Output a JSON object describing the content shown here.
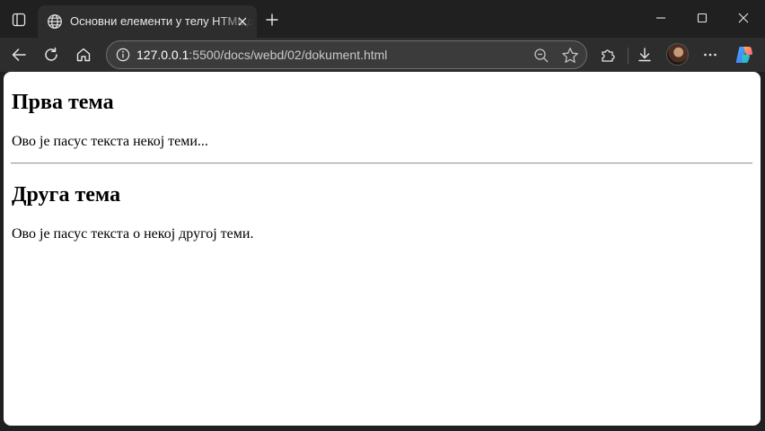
{
  "browser": {
    "tab": {
      "title": "Основни елементи у телу HTML документа"
    },
    "address_bar": {
      "url_host": "127.0.0.1",
      "url_rest": ":5500/docs/webd/02/dokument.html"
    },
    "icons": {
      "tab_actions": "tab-actions-icon",
      "tab_favicon": "globe-icon",
      "tab_close": "close-icon",
      "new_tab": "plus-icon",
      "minimize": "minimize-icon",
      "maximize": "maximize-icon",
      "close_window": "close-window-icon",
      "back": "back-arrow-icon",
      "refresh": "refresh-icon",
      "home": "home-icon",
      "site_info": "info-icon",
      "zoom": "zoom-out-icon",
      "favorite": "star-icon",
      "extensions": "puzzle-icon",
      "downloads": "download-icon",
      "profile": "avatar",
      "more": "more-dots-icon",
      "copilot": "copilot-icon"
    },
    "colors": {
      "chrome_dark": "#202020",
      "toolbar": "#2d2d2d",
      "omnibox": "#3b3b3b",
      "page_bg": "#ffffff"
    }
  },
  "page": {
    "heading_1": "Прва тема",
    "paragraph_1": "Ово је пасус текста некој теми...",
    "heading_2": "Друга тема",
    "paragraph_2": "Ово је пасус текста о некој другој теми."
  }
}
